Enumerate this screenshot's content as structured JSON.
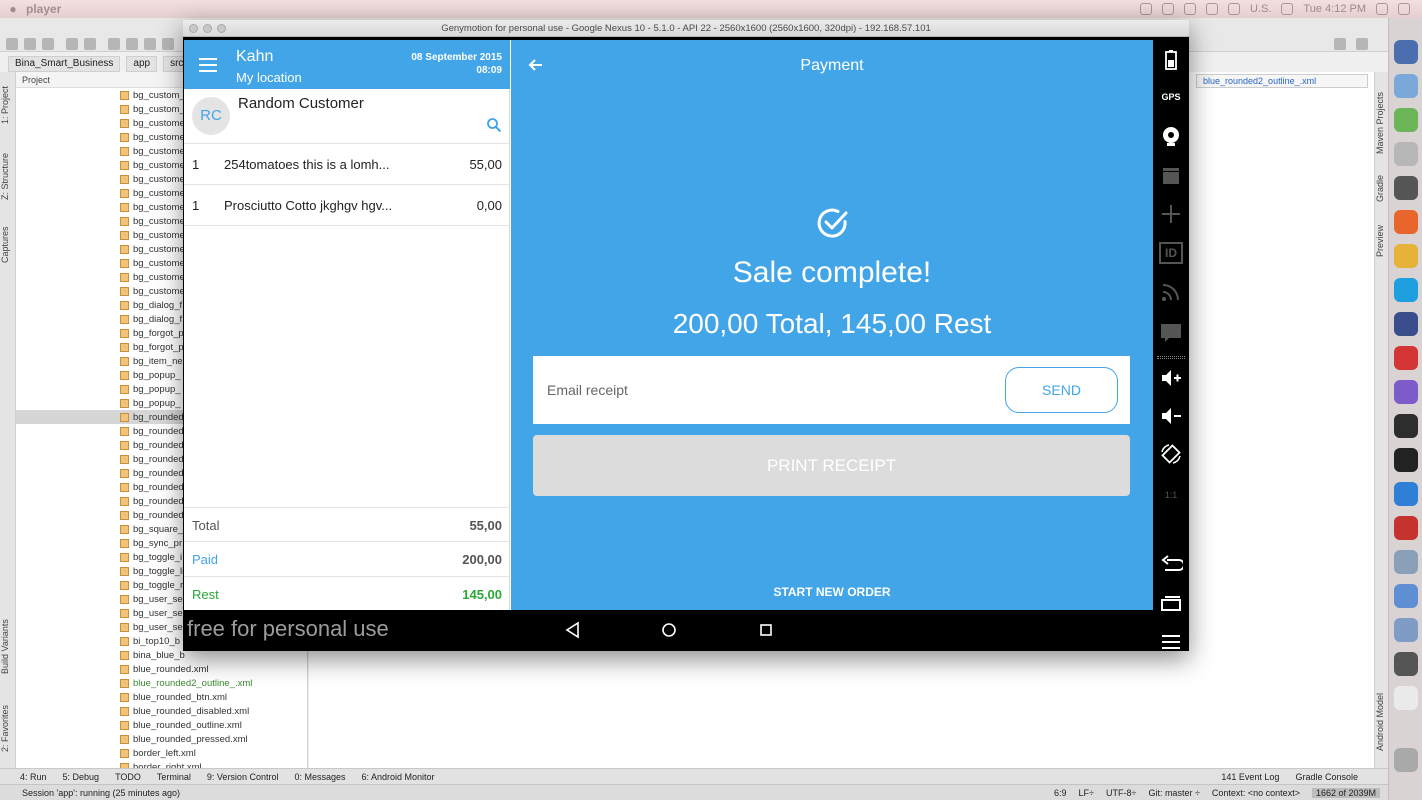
{
  "mac": {
    "app_name": "player",
    "locale": "U.S.",
    "clock": "Tue 4:12 PM"
  },
  "ide": {
    "breadcrumbs": [
      "Bina_Smart_Business",
      "app",
      "src"
    ],
    "project_dropdown": "Project",
    "editor_tab": "blue_rounded2_outline_.xml",
    "left_tool_tabs": [
      "1: Project",
      "Z: Structure",
      "Captures",
      "Build Variants",
      "2: Favorites"
    ],
    "right_tool_tabs": [
      "Maven Projects",
      "Gradle",
      "Preview",
      "Android Model"
    ],
    "files": [
      {
        "name": "bg_custom_",
        "green": false
      },
      {
        "name": "bg_custom_",
        "green": false
      },
      {
        "name": "bg_custome",
        "green": false
      },
      {
        "name": "bg_custome",
        "green": false
      },
      {
        "name": "bg_custome",
        "green": false
      },
      {
        "name": "bg_custome",
        "green": false
      },
      {
        "name": "bg_custome",
        "green": false
      },
      {
        "name": "bg_custome",
        "green": false
      },
      {
        "name": "bg_custome",
        "green": false
      },
      {
        "name": "bg_custome",
        "green": false
      },
      {
        "name": "bg_custome",
        "green": false
      },
      {
        "name": "bg_custome",
        "green": false
      },
      {
        "name": "bg_custome",
        "green": false
      },
      {
        "name": "bg_custome",
        "green": false
      },
      {
        "name": "bg_custome",
        "green": false
      },
      {
        "name": "bg_dialog_f",
        "green": false
      },
      {
        "name": "bg_dialog_f",
        "green": false
      },
      {
        "name": "bg_forgot_p",
        "green": false
      },
      {
        "name": "bg_forgot_p",
        "green": false
      },
      {
        "name": "bg_item_ne",
        "green": false
      },
      {
        "name": "bg_popup_",
        "green": false
      },
      {
        "name": "bg_popup_",
        "green": false
      },
      {
        "name": "bg_popup_",
        "green": false
      },
      {
        "name": "bg_rounded",
        "green": false,
        "selected": true
      },
      {
        "name": "bg_rounded",
        "green": false
      },
      {
        "name": "bg_rounded",
        "green": false
      },
      {
        "name": "bg_rounded",
        "green": false
      },
      {
        "name": "bg_rounded",
        "green": false
      },
      {
        "name": "bg_rounded",
        "green": false
      },
      {
        "name": "bg_rounded",
        "green": false
      },
      {
        "name": "bg_rounded",
        "green": false
      },
      {
        "name": "bg_square_",
        "green": false
      },
      {
        "name": "bg_sync_pr",
        "green": false
      },
      {
        "name": "bg_toggle_i",
        "green": false
      },
      {
        "name": "bg_toggle_li",
        "green": false
      },
      {
        "name": "bg_toggle_r",
        "green": false
      },
      {
        "name": "bg_user_se",
        "green": false
      },
      {
        "name": "bg_user_se",
        "green": false
      },
      {
        "name": "bg_user_se",
        "green": false
      },
      {
        "name": "bi_top10_b",
        "green": false
      },
      {
        "name": "bina_blue_b",
        "green": false
      },
      {
        "name": "blue_rounded.xml",
        "green": false
      },
      {
        "name": "blue_rounded2_outline_.xml",
        "green": true
      },
      {
        "name": "blue_rounded_btn.xml",
        "green": false
      },
      {
        "name": "blue_rounded_disabled.xml",
        "green": false
      },
      {
        "name": "blue_rounded_outline.xml",
        "green": false
      },
      {
        "name": "blue_rounded_pressed.xml",
        "green": false
      },
      {
        "name": "border_left.xml",
        "green": false
      },
      {
        "name": "border_right.xml",
        "green": false
      }
    ],
    "bottom_tabs": [
      "4: Run",
      "5: Debug",
      "TODO",
      "Terminal",
      "9: Version Control",
      "0: Messages",
      "6: Android Monitor"
    ],
    "bottom_tabs_right": [
      "141 Event Log",
      "Gradle Console"
    ],
    "status_left": "Session 'app': running (25 minutes ago)",
    "status_right": [
      "6:9",
      "LF÷",
      "UTF-8÷",
      "Git: master ÷",
      "Context: <no context>"
    ],
    "memory": "1662 of 2039M"
  },
  "emulator": {
    "window_title": "Genymotion for personal use - Google Nexus 10 - 5.1.0 - API 22 - 2560x1600 (2560x1600, 320dpi) - 192.168.57.101",
    "watermark": "free for personal use",
    "sidebar_labels": {
      "gps": "GPS",
      "id": "ID",
      "ratio": "1:1"
    }
  },
  "app": {
    "store_name": "Kahn",
    "location": "My location",
    "date": "08 September 2015",
    "time": "08:09",
    "customer": {
      "initials": "RC",
      "name": "Random Customer"
    },
    "order_lines": [
      {
        "qty": "1",
        "name": "254tomatoes this is a lomh...",
        "price": "55,00"
      },
      {
        "qty": "1",
        "name": "Prosciutto Cotto jkghgv hgv...",
        "price": "0,00"
      }
    ],
    "totals": {
      "total_label": "Total",
      "total_value": "55,00",
      "paid_label": "Paid",
      "paid_value": "200,00",
      "rest_label": "Rest",
      "rest_value": "145,00"
    },
    "payment": {
      "title": "Payment",
      "sale_complete": "Sale complete!",
      "summary": "200,00 Total, 145,00 Rest",
      "email_placeholder": "Email receipt",
      "send_label": "SEND",
      "print_label": "PRINT RECEIPT",
      "new_order_label": "START NEW ORDER"
    },
    "colors": {
      "primary": "#42a5e8",
      "paid": "#42a5e8",
      "rest": "#2aa836",
      "disabled": "#dcdcdc"
    }
  }
}
